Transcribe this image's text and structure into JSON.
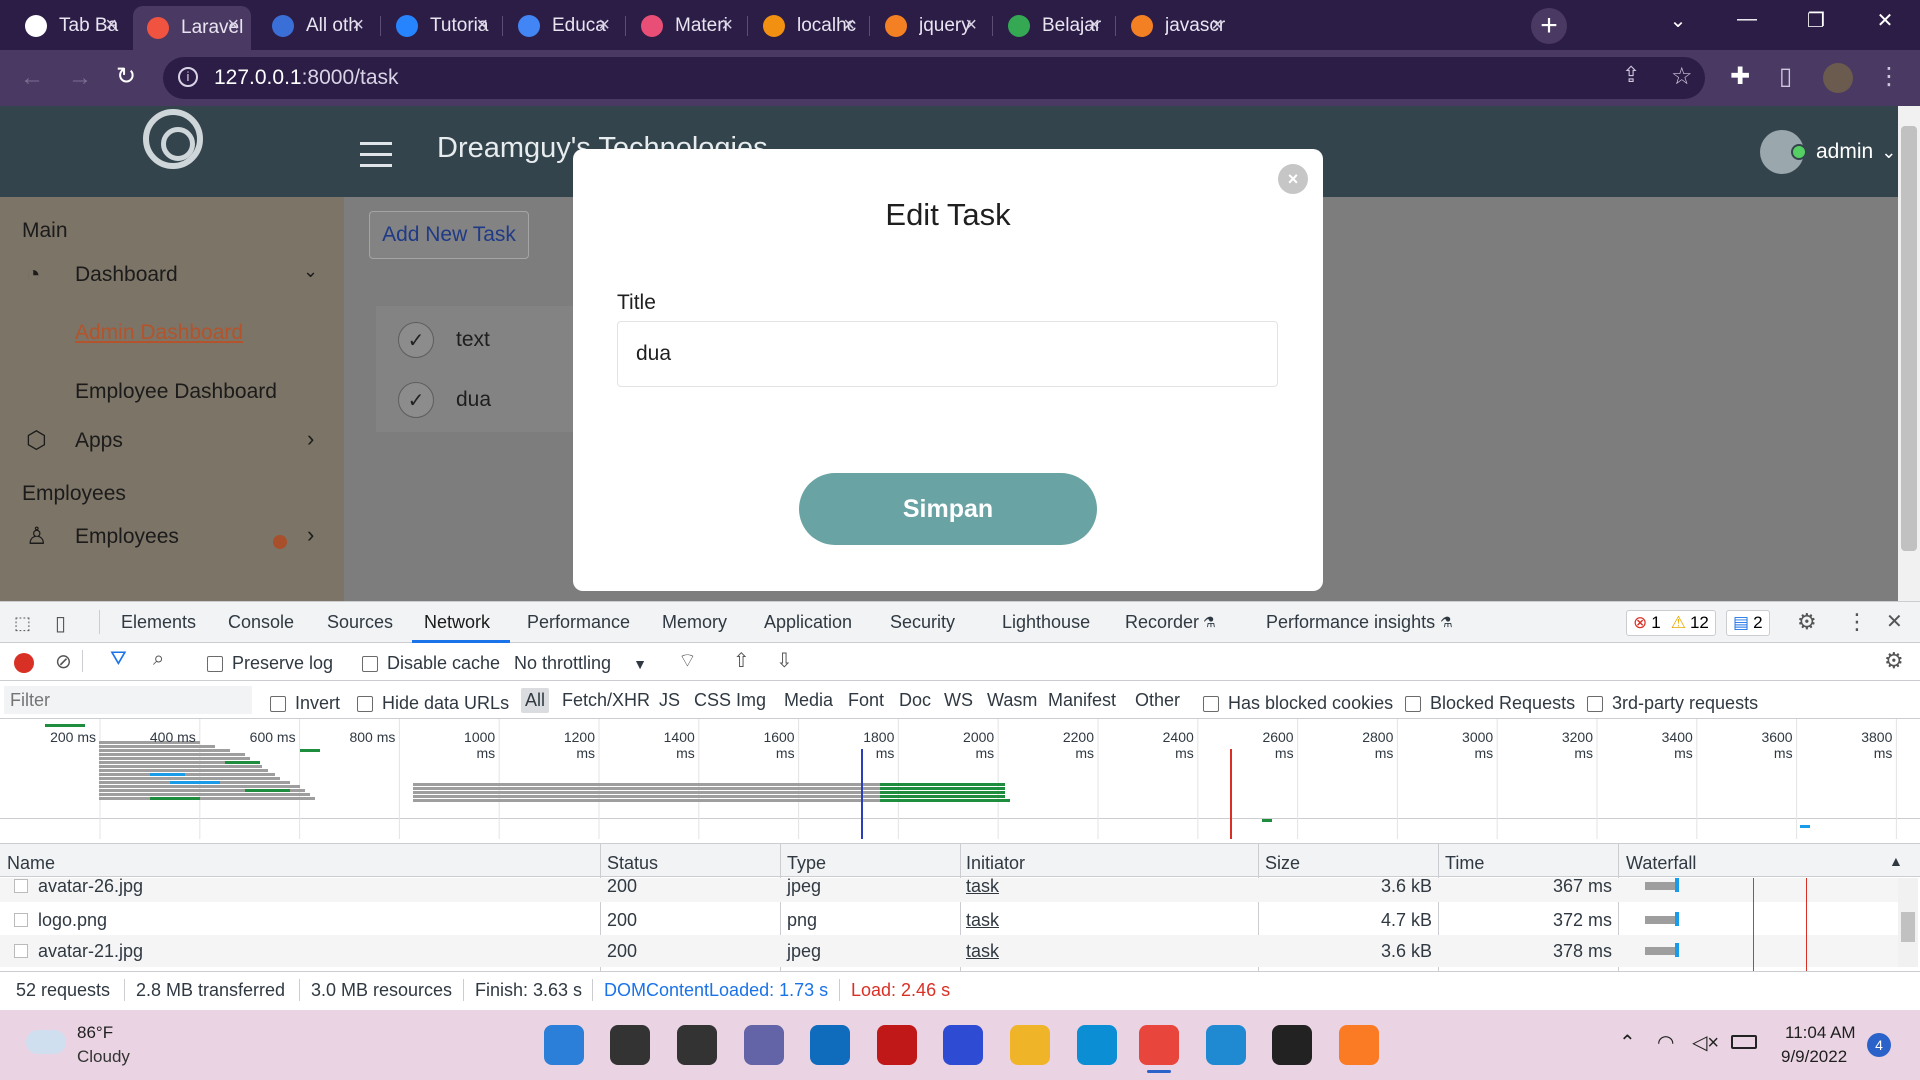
{
  "browser": {
    "tabs": [
      {
        "label": "Tab Ba",
        "color": "#ffffff"
      },
      {
        "label": "Laravel",
        "color": "#f05340"
      },
      {
        "label": "All oth",
        "color": "#3b6fd8"
      },
      {
        "label": "Tutoria",
        "color": "#2684ff"
      },
      {
        "label": "Educa",
        "color": "#4285f4"
      },
      {
        "label": "Materi",
        "color": "#e94e77"
      },
      {
        "label": "localhc",
        "color": "#f29111"
      },
      {
        "label": "jquery",
        "color": "#f48024"
      },
      {
        "label": "Belajar",
        "color": "#34a853"
      },
      {
        "label": "javascr",
        "color": "#f48024"
      }
    ],
    "url_host": "127.0.0.1",
    "url_path": ":8000/task"
  },
  "app": {
    "brand": "Dreamguy's Technologies",
    "user": "admin",
    "sidebar": {
      "main": "Main",
      "dashboard": "Dashboard",
      "admin_dashboard": "Admin Dashboard",
      "employee_dashboard": "Employee Dashboard",
      "apps": "Apps",
      "employees_section": "Employees",
      "employees": "Employees"
    },
    "add_button": "Add New Task",
    "tasks": [
      "text",
      "dua"
    ]
  },
  "modal": {
    "title": "Edit Task",
    "field_label": "Title",
    "field_value": "dua",
    "save": "Simpan",
    "close": "×",
    "accent": "#6aa3a4"
  },
  "devtools": {
    "tabs": [
      "Elements",
      "Console",
      "Sources",
      "Network",
      "Performance",
      "Memory",
      "Application",
      "Security",
      "Lighthouse",
      "Recorder",
      "Performance insights"
    ],
    "active_tab": "Network",
    "errors": "1",
    "warnings": "12",
    "messages": "2",
    "preserve_log": "Preserve log",
    "disable_cache": "Disable cache",
    "throttling": "No throttling",
    "filter_placeholder": "Filter",
    "invert": "Invert",
    "hide_data_urls": "Hide data URLs",
    "filter_types": [
      "All",
      "Fetch/XHR",
      "JS",
      "CSS",
      "Img",
      "Media",
      "Font",
      "Doc",
      "WS",
      "Wasm",
      "Manifest",
      "Other"
    ],
    "has_blocked_cookies": "Has blocked cookies",
    "blocked_requests": "Blocked Requests",
    "third_party": "3rd-party requests",
    "ticks": [
      "200 ms",
      "400 ms",
      "600 ms",
      "800 ms",
      "1000 ms",
      "1200 ms",
      "1400 ms",
      "1600 ms",
      "1800 ms",
      "2000 ms",
      "2200 ms",
      "2400 ms",
      "2600 ms",
      "2800 ms",
      "3000 ms",
      "3200 ms",
      "3400 ms",
      "3600 ms",
      "3800 ms"
    ],
    "columns": [
      "Name",
      "Status",
      "Type",
      "Initiator",
      "Size",
      "Time",
      "Waterfall"
    ],
    "rows": [
      {
        "name": "avatar-26.jpg",
        "status": "200",
        "type": "jpeg",
        "initiator": "task",
        "size": "3.6 kB",
        "time": "367 ms"
      },
      {
        "name": "logo.png",
        "status": "200",
        "type": "png",
        "initiator": "task",
        "size": "4.7 kB",
        "time": "372 ms"
      },
      {
        "name": "avatar-21.jpg",
        "status": "200",
        "type": "jpeg",
        "initiator": "task",
        "size": "3.6 kB",
        "time": "378 ms"
      }
    ],
    "summary": {
      "requests": "52 requests",
      "transferred": "2.8 MB transferred",
      "resources": "3.0 MB resources",
      "finish": "Finish: 3.63 s",
      "dcl": "DOMContentLoaded: 1.73 s",
      "load": "Load: 2.46 s"
    }
  },
  "taskbar": {
    "temperature": "86°F",
    "weather": "Cloudy",
    "time": "11:04 AM",
    "date": "9/9/2022",
    "notifications": "4"
  }
}
